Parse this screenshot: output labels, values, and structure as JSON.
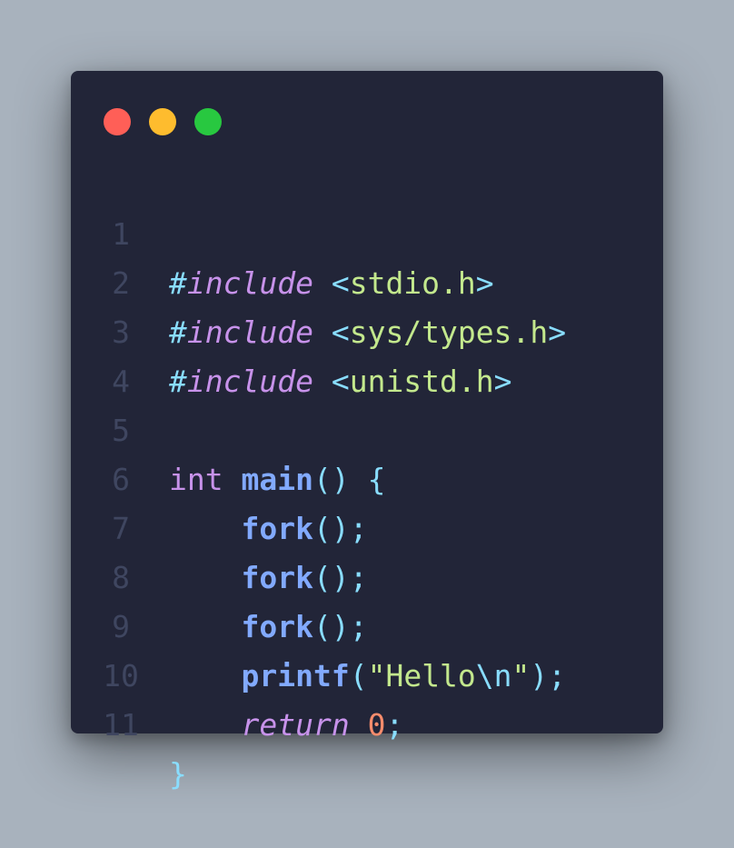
{
  "window": {
    "controls": [
      "close",
      "minimize",
      "maximize"
    ]
  },
  "code": {
    "lines": [
      {
        "n": "1",
        "hash": "#",
        "directive": "include",
        "open": "<",
        "header": "stdio.h",
        "close": ">"
      },
      {
        "n": "2",
        "hash": "#",
        "directive": "include",
        "open": "<",
        "header": "sys/types.h",
        "close": ">"
      },
      {
        "n": "3",
        "hash": "#",
        "directive": "include",
        "open": "<",
        "header": "unistd.h",
        "close": ">"
      },
      {
        "n": "4"
      },
      {
        "n": "5",
        "type": "int",
        "name": "main",
        "parens": "()",
        "brace": "{"
      },
      {
        "n": "6",
        "call": "fork",
        "parens": "()",
        "semi": ";"
      },
      {
        "n": "7",
        "call": "fork",
        "parens": "()",
        "semi": ";"
      },
      {
        "n": "8",
        "call": "fork",
        "parens": "()",
        "semi": ";"
      },
      {
        "n": "9",
        "call": "printf",
        "open": "(",
        "quote_open": "\"",
        "text": "Hello",
        "escape": "\\n",
        "quote_close": "\"",
        "close": ")",
        "semi": ";"
      },
      {
        "n": "10",
        "keyword": "return",
        "value": "0",
        "semi": ";"
      },
      {
        "n": "11",
        "brace": "}"
      }
    ]
  }
}
